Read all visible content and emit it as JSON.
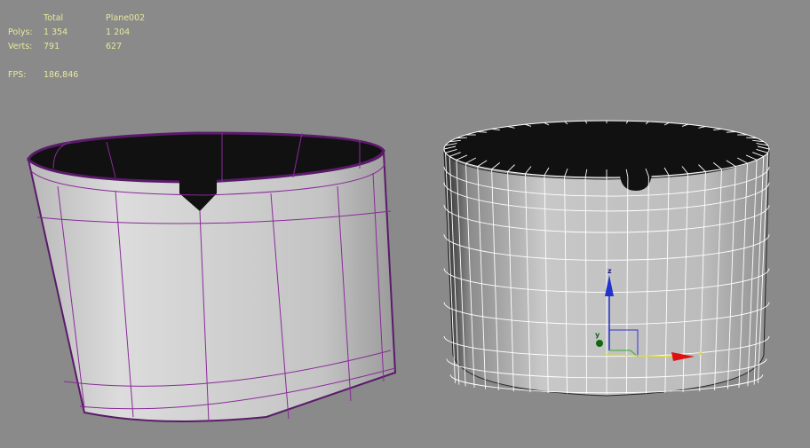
{
  "stats": {
    "col_total": "Total",
    "col_object": "Plane002",
    "polys_label": "Polys:",
    "polys_total": "1 354",
    "polys_object": "1 204",
    "verts_label": "Verts:",
    "verts_total": "791",
    "verts_object": "627",
    "fps_label": "FPS:",
    "fps_value": "186,846"
  },
  "gizmo": {
    "x_label": "x",
    "y_label": "y",
    "z_label": "z"
  },
  "colors": {
    "background": "#8a8a8a",
    "stats_text": "#e8e89a",
    "edges_selected": "#8a2a9a",
    "wire": "#ffffff"
  }
}
